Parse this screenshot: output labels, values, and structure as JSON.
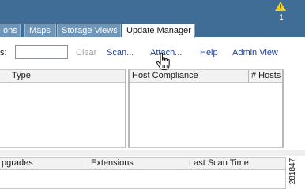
{
  "alerts": {
    "count": "1"
  },
  "tabs": [
    {
      "label": "ons"
    },
    {
      "label": "Maps"
    },
    {
      "label": "Storage Views"
    },
    {
      "label": "Update Manager"
    }
  ],
  "toolbar": {
    "filter_label": "s:",
    "search_value": "",
    "clear_label": "Clear",
    "scan_label": "Scan...",
    "attach_label": "Attach...",
    "help_label": "Help",
    "admin_view_label": "Admin View"
  },
  "baselines_table": {
    "columns": [
      "Type"
    ]
  },
  "compliance_table": {
    "columns": [
      "Host Compliance",
      "# Hosts"
    ]
  },
  "details_table": {
    "columns": [
      "pgrades",
      "Extensions",
      "Last Scan Time"
    ]
  },
  "figure_number": "281847"
}
